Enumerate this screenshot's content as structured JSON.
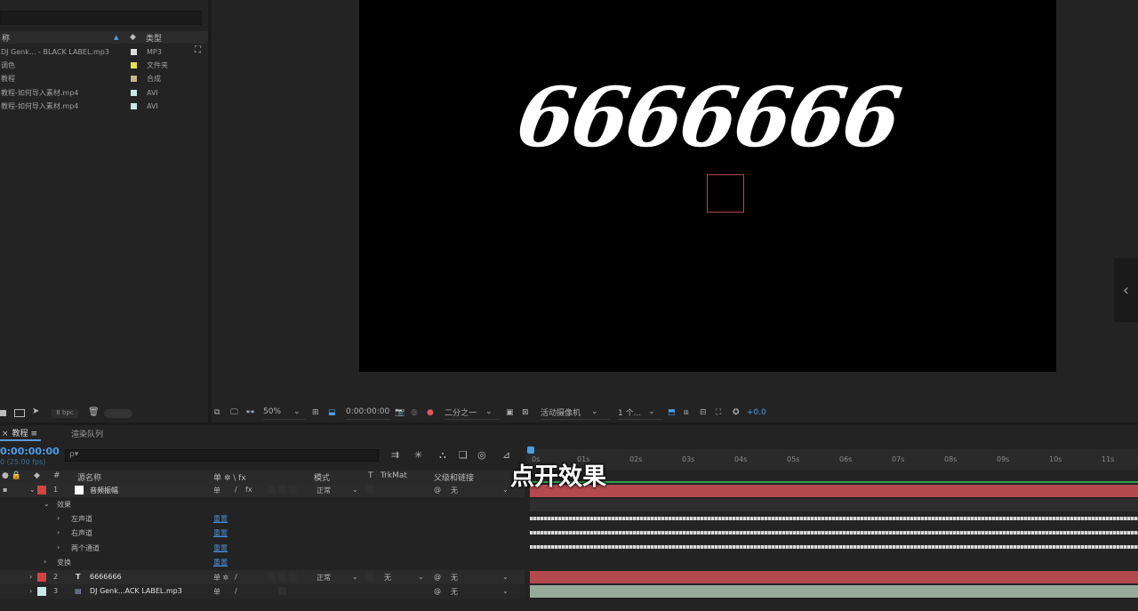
{
  "project": {
    "header": {
      "name": "称",
      "type": "类型"
    },
    "items": [
      {
        "name": "DJ Genk... - BLACK LABEL.mp3",
        "color": "#dcdcdc",
        "type": "MP3"
      },
      {
        "name": "调色",
        "color": "#e8e048",
        "type": "文件夹"
      },
      {
        "name": "教程",
        "color": "#c8b48a",
        "type": "合成"
      },
      {
        "name": "教程-如何导入素材.mp4",
        "color": "#c7e8e4",
        "type": "AVI"
      },
      {
        "name": "教程-如何导入素材.mp4",
        "color": "#c7e8e4",
        "type": "AVI"
      }
    ],
    "bpc": "8 bpc"
  },
  "viewer": {
    "canvas_text": "6666666",
    "zoom": "50%",
    "timecode": "0:00:00:00",
    "resolution": "二分之一",
    "camera": "活动摄像机",
    "views": "1 个...",
    "exposure": "+0.0",
    "side_tab_icon": "chevron-left"
  },
  "timeline": {
    "tab_comp": "教程",
    "tab_menu": "≡",
    "tab_queue": "渲染队列",
    "timecode": "0:00:00:00",
    "fps": "0 (25.00 fps)",
    "search_placeholder": "ρ▾",
    "columns": {
      "hash": "#",
      "source": "源名称",
      "switches": "单 ✲ \\ fx",
      "mode": "模式",
      "t": "T",
      "trkmat": "TrkMat",
      "parent": "父级和链接"
    },
    "ruler": [
      "0s",
      "01s",
      "02s",
      "03s",
      "04s",
      "05s",
      "06s",
      "07s",
      "08s",
      "09s",
      "10s",
      "11s"
    ],
    "layers": [
      {
        "num": "1",
        "color": "#d04444",
        "name": "音频振幅",
        "mode": "正常",
        "parent": "无"
      },
      {
        "num": "2",
        "color": "#d04444",
        "type_icon": "T",
        "name": "6666666",
        "mode": "正常",
        "trkmat": "无",
        "parent": "无"
      },
      {
        "num": "3",
        "color": "#c7e8e4",
        "name": "DJ Genk...ACK LABEL.mp3",
        "parent": "无"
      }
    ],
    "effects_label": "效果",
    "effects": [
      "左声道",
      "右声道",
      "两个通道"
    ],
    "transform_label": "变换",
    "reset_label": "重置"
  },
  "caption": "点开效果"
}
